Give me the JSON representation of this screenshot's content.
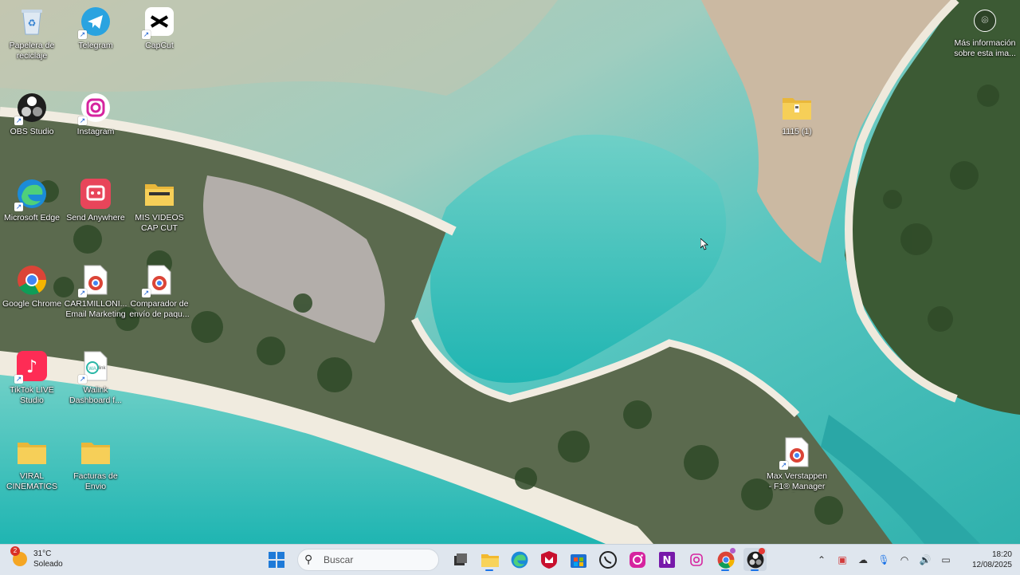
{
  "desktop": {
    "icons": [
      {
        "label": "Papelera de reciclaje",
        "icon": "recycle-bin-icon"
      },
      {
        "label": "Telegram",
        "icon": "telegram-icon"
      },
      {
        "label": "CapCut",
        "icon": "capcut-icon"
      },
      {
        "label": "OBS Studio",
        "icon": "obs-icon"
      },
      {
        "label": "Instagram",
        "icon": "instagram-icon"
      },
      {
        "label": "Microsoft Edge",
        "icon": "edge-icon"
      },
      {
        "label": "Send Anywhere",
        "icon": "send-anywhere-icon"
      },
      {
        "label": "MIS VIDEOS CAP CUT",
        "icon": "folder-icon"
      },
      {
        "label": "Google Chrome",
        "icon": "chrome-icon"
      },
      {
        "label": "CAR1MILLONI... Email Marketing",
        "icon": "chrome-file-icon"
      },
      {
        "label": "Comparador de envío de paqu...",
        "icon": "chrome-file-icon"
      },
      {
        "label": "TikTok LIVE Studio",
        "icon": "tiktok-icon"
      },
      {
        "label": "Walink Dashboard f...",
        "icon": "walink-icon"
      },
      {
        "label": "VIRAL CINEMATICS",
        "icon": "folder-icon"
      },
      {
        "label": "Facturas de Envio",
        "icon": "folder-icon"
      },
      {
        "label": "1115 (1)",
        "icon": "zip-folder-icon"
      },
      {
        "label": "Max Verstappen - F1® Manager 2...",
        "icon": "chrome-file-icon"
      }
    ],
    "info": {
      "label": "Más información sobre esta ima..."
    }
  },
  "taskbar": {
    "weather": {
      "temp": "31°C",
      "condition": "Soleado",
      "badge": "2"
    },
    "search": {
      "placeholder": "Buscar"
    },
    "apps": [
      "start-icon",
      "task-view-icon",
      "file-explorer-icon",
      "edge-icon",
      "mcafee-icon",
      "store-icon",
      "whatsapp-icon",
      "instagram-icon",
      "onenote-icon",
      "instagram-alt-icon",
      "chrome-icon",
      "obs-icon"
    ],
    "clock": {
      "time": "18:20",
      "date": "12/08/2025"
    }
  },
  "colors": {
    "accent": "#1a73e8",
    "taskbar_bg": "#dfe6ee"
  }
}
